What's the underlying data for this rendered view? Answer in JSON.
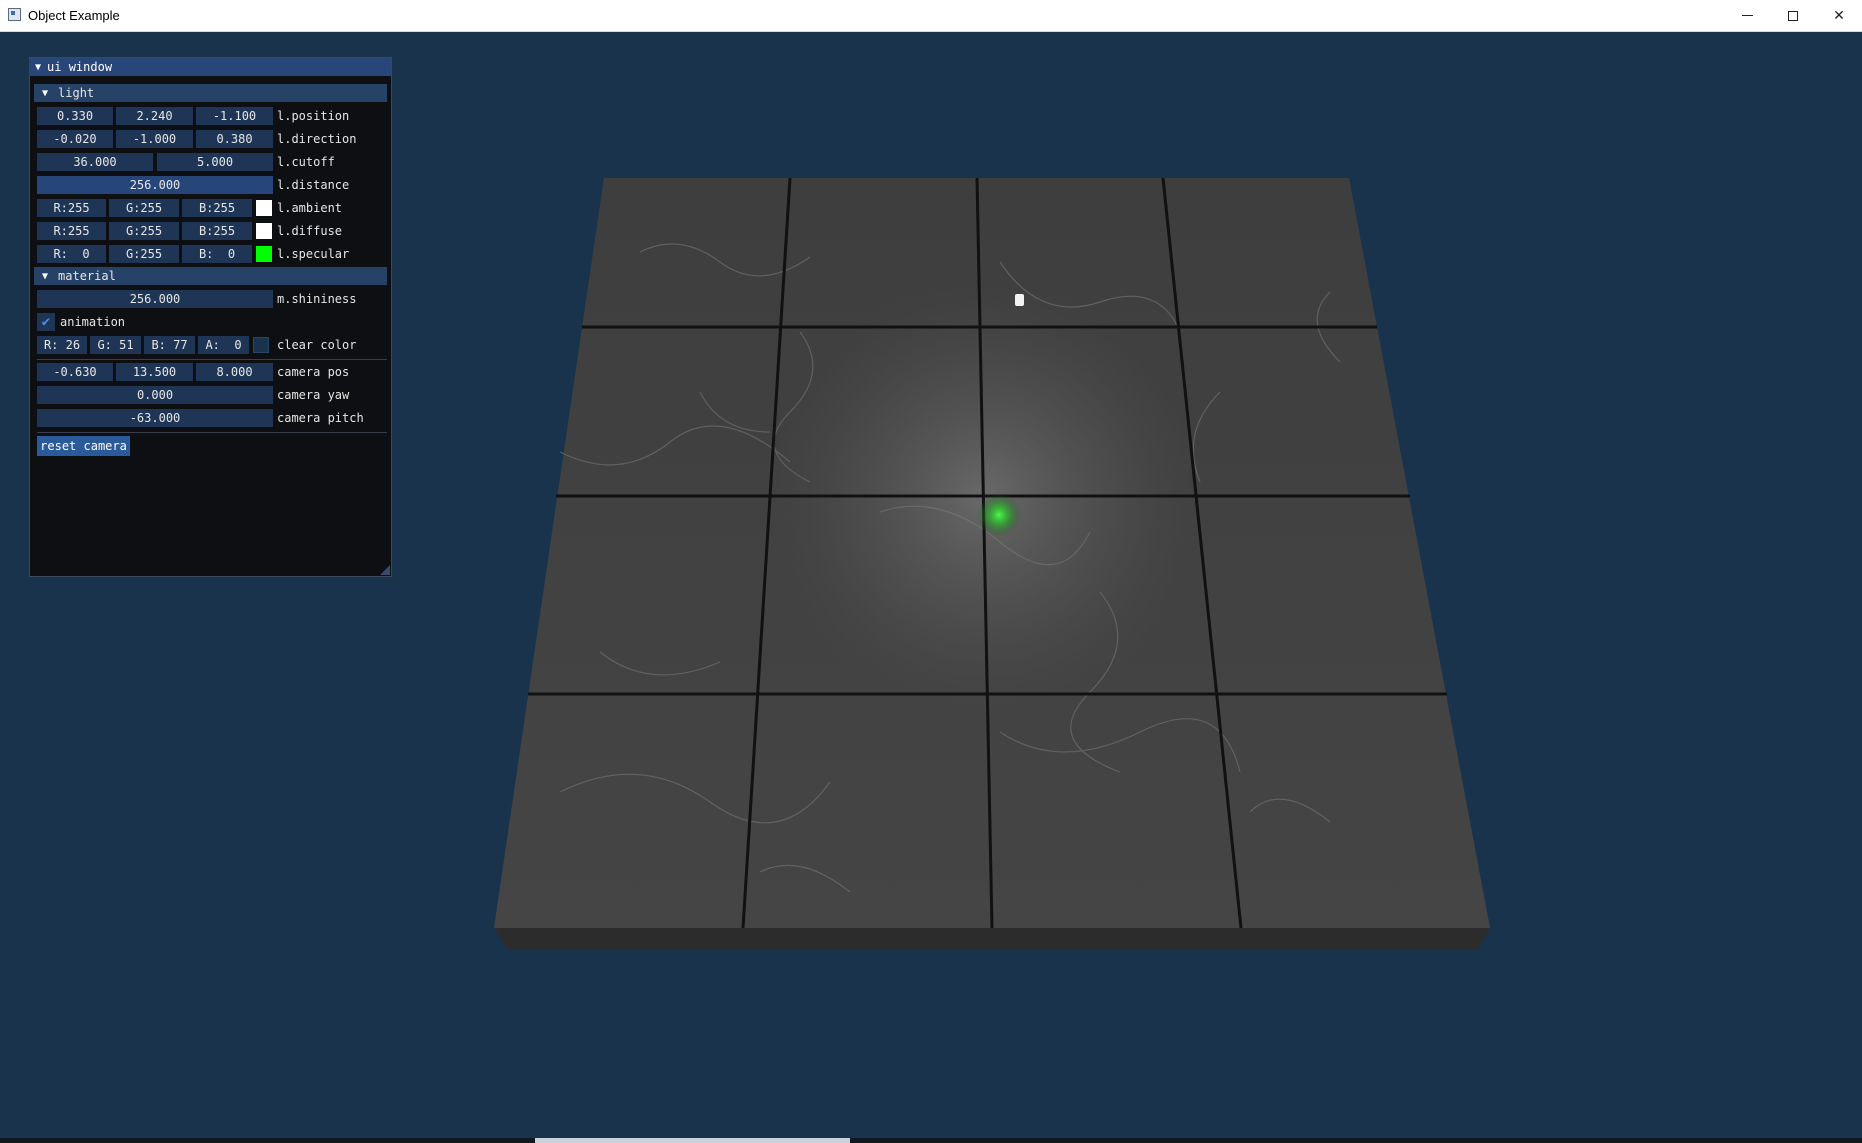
{
  "window": {
    "title": "Object Example"
  },
  "imgui": {
    "title": "ui window",
    "light": {
      "header": "light",
      "position": {
        "values": [
          "0.330",
          "2.240",
          "-1.100"
        ],
        "label": "l.position"
      },
      "direction": {
        "values": [
          "-0.020",
          "-1.000",
          "0.380"
        ],
        "label": "l.direction"
      },
      "cutoff": {
        "values": [
          "36.000",
          "5.000"
        ],
        "label": "l.cutoff"
      },
      "distance": {
        "value": "256.000",
        "label": "l.distance"
      },
      "ambient": {
        "values": [
          "R:255",
          "G:255",
          "B:255"
        ],
        "label": "l.ambient",
        "color": "#ffffff"
      },
      "diffuse": {
        "values": [
          "R:255",
          "G:255",
          "B:255"
        ],
        "label": "l.diffuse",
        "color": "#ffffff"
      },
      "specular": {
        "values": [
          "R:  0",
          "G:255",
          "B:  0"
        ],
        "label": "l.specular",
        "color": "#00ff00"
      }
    },
    "material": {
      "header": "material",
      "shininess": {
        "value": "256.000",
        "label": "m.shininess"
      }
    },
    "animation": {
      "label": "animation",
      "checked": true
    },
    "clear_color": {
      "values": [
        "R: 26",
        "G: 51",
        "B: 77",
        "A:  0"
      ],
      "label": "clear color",
      "color": "#1a334d"
    },
    "camera_pos": {
      "values": [
        "-0.630",
        "13.500",
        "8.000"
      ],
      "label": "camera pos"
    },
    "camera_yaw": {
      "value": "0.000",
      "label": "camera yaw"
    },
    "camera_pitch": {
      "value": "-63.000",
      "label": "camera pitch"
    },
    "reset_button": "reset camera"
  }
}
